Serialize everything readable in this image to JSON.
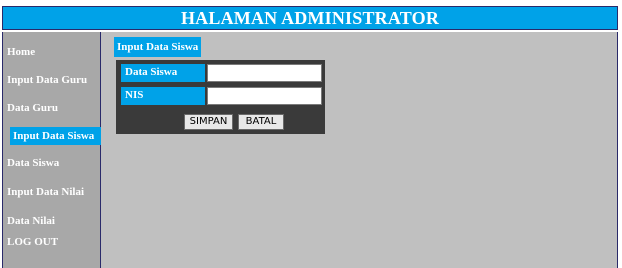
{
  "header": {
    "title": "HALAMAN ADMINISTRATOR"
  },
  "sidebar": {
    "items": [
      {
        "label": "Home",
        "active": false
      },
      {
        "label": "Input Data Guru",
        "active": false
      },
      {
        "label": "Data Guru",
        "active": false
      },
      {
        "label": "Input Data Siswa",
        "active": true
      },
      {
        "label": "Data Siswa",
        "active": false
      },
      {
        "label": "Input Data Nilai",
        "active": false
      },
      {
        "label": "Data Nilai",
        "active": false
      },
      {
        "label": "LOG OUT",
        "active": false
      }
    ]
  },
  "form": {
    "title": "Input Data Siswa",
    "fields": [
      {
        "label": "Data Siswa",
        "value": "",
        "placeholder": ""
      },
      {
        "label": "NIS",
        "value": "",
        "placeholder": ""
      }
    ],
    "buttons": {
      "save_label": "SIMPAN",
      "cancel_label": "BATAL"
    }
  },
  "colors": {
    "accent": "#00a2e8",
    "sidebar_bg": "#a8a8a8",
    "main_bg": "#c0c0c0",
    "form_bg": "#3a3a3a"
  }
}
